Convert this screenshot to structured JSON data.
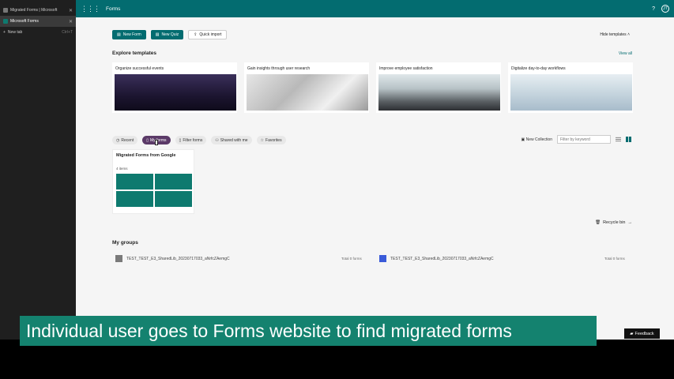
{
  "browser": {
    "tabs": [
      {
        "label": "Migrated Forms | Microsoft",
        "active": false
      },
      {
        "label": "Microsoft Forms",
        "active": true
      }
    ],
    "new_tab_label": "New tab",
    "new_tab_shortcut": "Ctrl+T"
  },
  "app": {
    "title": "Forms",
    "help": "?",
    "avatar_initials": "JT"
  },
  "actions": {
    "new_form": "New Form",
    "new_quiz": "New Quiz",
    "quick_import": "Quick import",
    "hide_templates": "Hide templates"
  },
  "explore": {
    "title": "Explore templates",
    "view_all": "View all",
    "templates": [
      {
        "label": "Organize successful events"
      },
      {
        "label": "Gain insights through user research"
      },
      {
        "label": "Improve employee satisfaction"
      },
      {
        "label": "Digitalize day-to-day workflows"
      }
    ]
  },
  "filters": {
    "recent": "Recent",
    "my_forms": "My forms",
    "filter_forms": "Filter forms",
    "shared": "Shared with me",
    "favorites": "Favorites",
    "new_collection": "New Collection",
    "search_placeholder": "Filter by keyword"
  },
  "collection": {
    "title": "Migrated Forms from Google",
    "count": "4 items"
  },
  "recycle_bin": "Recycle bin",
  "groups": {
    "title": "My groups",
    "items": [
      {
        "name": "TEST_TEST_E3_SharedLib_20230717033_aNrfcZAemgC",
        "count": "Total 0 forms",
        "color": "#7a7a7a"
      },
      {
        "name": "TEST_TEST_E3_SharedLib_20230717033_aNrfcZAemgC",
        "count": "Total 0 forms",
        "color": "#3a5bd9"
      }
    ]
  },
  "caption": "Individual user goes to Forms website to find migrated forms",
  "feedback": "Feedback",
  "colors": {
    "brand": "#036c70",
    "accent_pill": "#5b3a68",
    "caption_bg": "#14826f"
  }
}
